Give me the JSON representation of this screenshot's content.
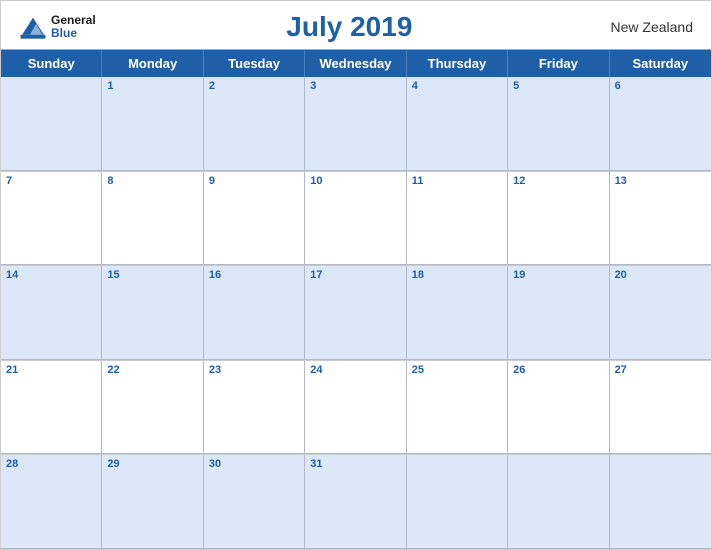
{
  "header": {
    "logo_general": "General",
    "logo_blue": "Blue",
    "month_title": "July 2019",
    "country": "New Zealand"
  },
  "day_headers": [
    "Sunday",
    "Monday",
    "Tuesday",
    "Wednesday",
    "Thursday",
    "Friday",
    "Saturday"
  ],
  "weeks": [
    [
      {
        "num": "",
        "empty": true
      },
      {
        "num": "1",
        "empty": false
      },
      {
        "num": "2",
        "empty": false
      },
      {
        "num": "3",
        "empty": false
      },
      {
        "num": "4",
        "empty": false
      },
      {
        "num": "5",
        "empty": false
      },
      {
        "num": "6",
        "empty": false
      }
    ],
    [
      {
        "num": "7",
        "empty": false
      },
      {
        "num": "8",
        "empty": false
      },
      {
        "num": "9",
        "empty": false
      },
      {
        "num": "10",
        "empty": false
      },
      {
        "num": "11",
        "empty": false
      },
      {
        "num": "12",
        "empty": false
      },
      {
        "num": "13",
        "empty": false
      }
    ],
    [
      {
        "num": "14",
        "empty": false
      },
      {
        "num": "15",
        "empty": false
      },
      {
        "num": "16",
        "empty": false
      },
      {
        "num": "17",
        "empty": false
      },
      {
        "num": "18",
        "empty": false
      },
      {
        "num": "19",
        "empty": false
      },
      {
        "num": "20",
        "empty": false
      }
    ],
    [
      {
        "num": "21",
        "empty": false
      },
      {
        "num": "22",
        "empty": false
      },
      {
        "num": "23",
        "empty": false
      },
      {
        "num": "24",
        "empty": false
      },
      {
        "num": "25",
        "empty": false
      },
      {
        "num": "26",
        "empty": false
      },
      {
        "num": "27",
        "empty": false
      }
    ],
    [
      {
        "num": "28",
        "empty": false
      },
      {
        "num": "29",
        "empty": false
      },
      {
        "num": "30",
        "empty": false
      },
      {
        "num": "31",
        "empty": false
      },
      {
        "num": "",
        "empty": true
      },
      {
        "num": "",
        "empty": true
      },
      {
        "num": "",
        "empty": true
      }
    ]
  ],
  "colors": {
    "header_bg": "#1e5fa8",
    "row_odd": "#dce8f8",
    "row_even": "#ffffff",
    "day_num": "#1e5fa8",
    "border": "#b0b8cc"
  }
}
